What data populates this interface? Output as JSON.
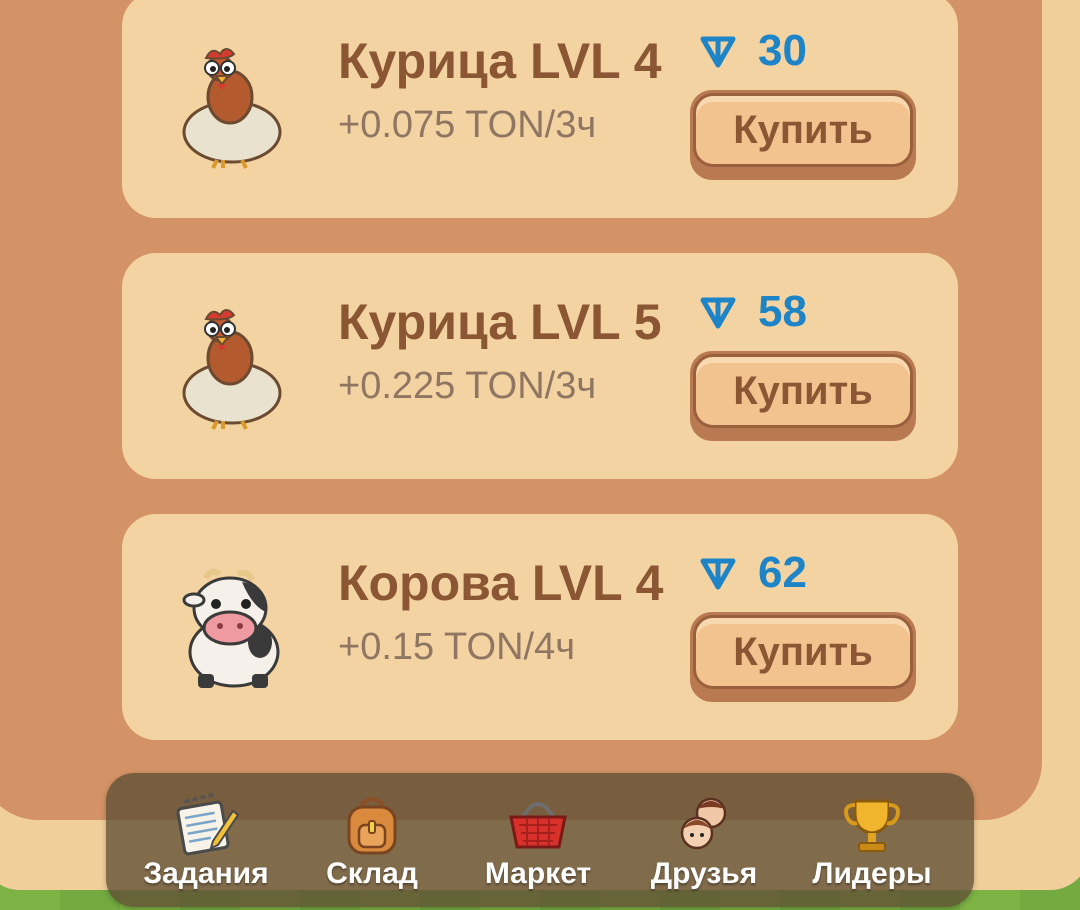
{
  "items": [
    {
      "title": "Курица LVL 4",
      "income": "+0.075 TON/3ч",
      "price": "30",
      "button": "Купить",
      "icon": "chicken-icon"
    },
    {
      "title": "Курица LVL 5",
      "income": "+0.225 TON/3ч",
      "price": "58",
      "button": "Купить",
      "icon": "chicken-icon"
    },
    {
      "title": "Корова LVL 4",
      "income": "+0.15 TON/4ч",
      "price": "62",
      "button": "Купить",
      "icon": "cow-icon"
    }
  ],
  "nav": [
    {
      "label": "Задания",
      "icon": "notepad-icon"
    },
    {
      "label": "Склад",
      "icon": "backpack-icon"
    },
    {
      "label": "Маркет",
      "icon": "basket-icon"
    },
    {
      "label": "Друзья",
      "icon": "friends-icon"
    },
    {
      "label": "Лидеры",
      "icon": "trophy-icon"
    }
  ],
  "colors": {
    "accent_price": "#1d85c7",
    "title_brown": "#8a5634",
    "card_bg": "#f3d3a2",
    "panel_bg": "#d39366"
  }
}
